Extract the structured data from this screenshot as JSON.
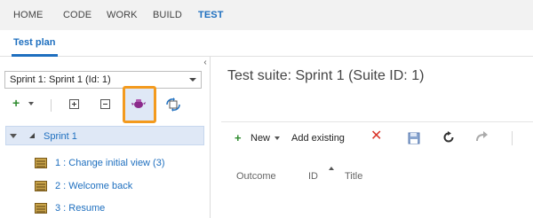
{
  "topnav": {
    "items": [
      "HOME",
      "CODE",
      "WORK",
      "BUILD",
      "TEST"
    ],
    "active": "TEST"
  },
  "subnav": {
    "tab": "Test plan"
  },
  "left": {
    "sprint_select_value": "Sprint 1: Sprint 1 (Id: 1)",
    "tree_root": "Sprint 1",
    "suites": [
      {
        "label": "1 : Change initial view (3)"
      },
      {
        "label": "2 : Welcome back"
      },
      {
        "label": "3 : Resume"
      }
    ]
  },
  "right": {
    "title": "Test suite: Sprint 1 (Suite ID: 1)",
    "toolbar": {
      "new_label": "New",
      "add_existing_label": "Add existing"
    },
    "columns": [
      "Outcome",
      "ID",
      "Title"
    ]
  },
  "colors": {
    "accent": "#1e6fbf",
    "highlight_border": "#f39a1e",
    "add_green": "#2e8b2e",
    "delete_red": "#d9352a"
  }
}
